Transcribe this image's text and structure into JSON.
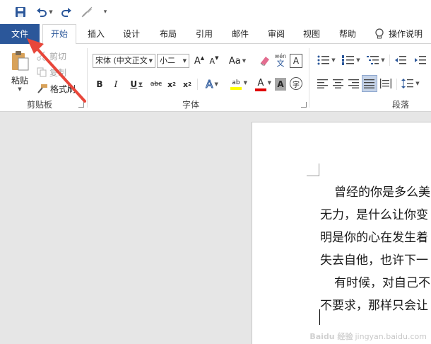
{
  "quick_access": {
    "save_icon": "save-icon",
    "undo_icon": "undo-icon",
    "redo_icon": "redo-icon",
    "format_painter_icon": "brush-icon",
    "customize_icon": "customize-quick-access-icon"
  },
  "tabs": [
    {
      "label": "文件"
    },
    {
      "label": "开始"
    },
    {
      "label": "插入"
    },
    {
      "label": "设计"
    },
    {
      "label": "布局"
    },
    {
      "label": "引用"
    },
    {
      "label": "邮件"
    },
    {
      "label": "审阅"
    },
    {
      "label": "视图"
    },
    {
      "label": "帮助"
    }
  ],
  "tell_me": {
    "label": "操作说明"
  },
  "clipboard": {
    "paste": "粘贴",
    "cut": "剪切",
    "copy": "复制",
    "format_painter": "格式刷",
    "group_label": "剪贴板"
  },
  "font": {
    "font_name": "宋体 (中文正文",
    "font_size": "小二",
    "grow": "A",
    "shrink": "A",
    "case": "Aa",
    "pinyin_top": "wén",
    "pinyin_bottom": "文",
    "border_char": "A",
    "bold": "B",
    "italic": "I",
    "underline": "U",
    "strike": "abc",
    "subscript": "x",
    "subscript_mark": "2",
    "superscript": "x",
    "superscript_mark": "2",
    "effects": "A",
    "highlight": "ab",
    "font_color": "A",
    "shading": "A",
    "enclose": "字",
    "group_label": "字体",
    "highlight_color": "#ffff00",
    "font_color_value": "#e00000"
  },
  "paragraph": {
    "group_label": "段落"
  },
  "document": {
    "lines": [
      "曾经的你是多么美",
      "无力，是什么让你变",
      "明是你的心在发生着",
      "失去自他，也许下一",
      "有时候，对自己不",
      "不要求，那样只会让"
    ]
  },
  "watermark": {
    "text": "jingyan.baidu.com",
    "brand": "Baidu 经验"
  },
  "colors": {
    "accent": "#2b579a",
    "arrow": "#e8463a"
  }
}
